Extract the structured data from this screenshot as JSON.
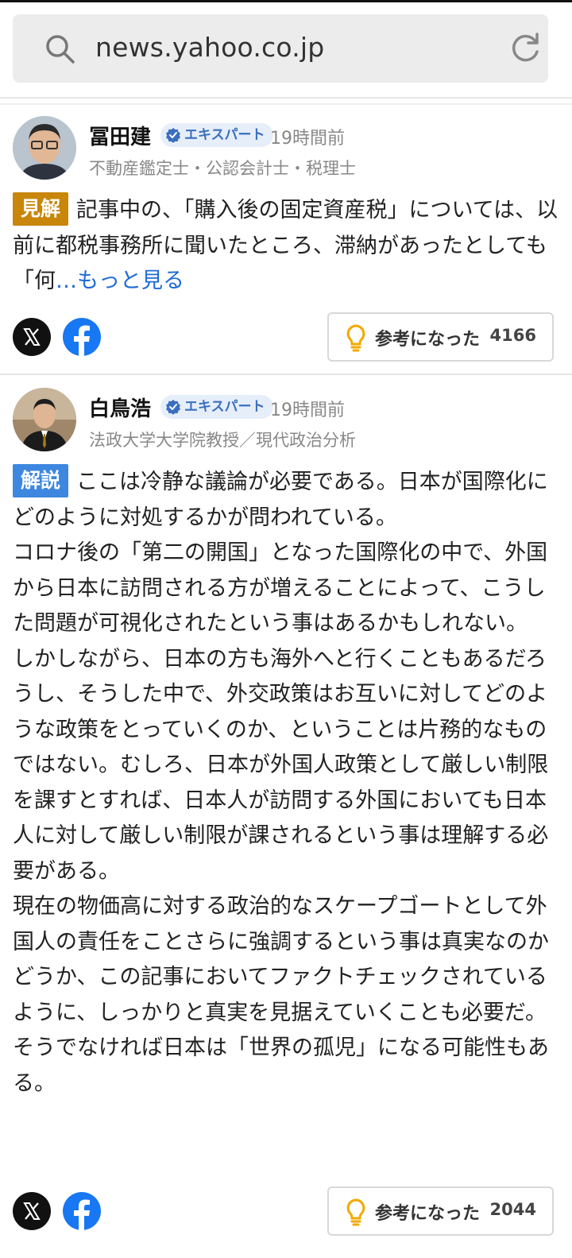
{
  "browser": {
    "url": "news.yahoo.co.jp"
  },
  "comments": [
    {
      "name": "冨田建",
      "badge": "エキスパート",
      "time": "19時間前",
      "role": "不動産鑑定士・公認会計士・税理士",
      "tag": "見解",
      "tag_color": "#c8860b",
      "text": "記事中の、「購入後の固定資産税」については、以前に都税事務所に聞いたところ、滞納があったとしても「何",
      "more": "…もっと見る",
      "helpful_label": "参考になった",
      "helpful_count": "4166"
    },
    {
      "name": "白鳥浩",
      "badge": "エキスパート",
      "time": "19時間前",
      "role": "法政大学大学院教授／現代政治分析",
      "tag": "解説",
      "tag_color": "#3d87e0",
      "text": "ここは冷静な議論が必要である。日本が国際化にどのように対処するかが問われている。\nコロナ後の「第二の開国」となった国際化の中で、外国から日本に訪問される方が増えることによって、こうした問題が可視化されたという事はあるかもしれない。\nしかしながら、日本の方も海外へと行くこともあるだろうし、そうした中で、外交政策はお互いに対してどのような政策をとっていくのか、ということは片務的なものではない。むしろ、日本が外国人政策として厳しい制限を課すとすれば、日本人が訪問する外国においても日本人に対して厳しい制限が課されるという事は理解する必要がある。\n現在の物価高に対する政治的なスケープゴートとして外国人の責任をことさらに強調するという事は真実なのかどうか、この記事においてファクトチェックされているように、しっかりと真実を見据えていくことも必要だ。\nそうでなければ日本は「世界の孤児」になる可能性もある。",
      "helpful_label": "参考になった",
      "helpful_count": "2044"
    }
  ],
  "icons": {
    "search": "search-icon",
    "reload": "reload-icon",
    "x": "x-logo-icon",
    "facebook": "facebook-icon",
    "bulb": "lightbulb-icon",
    "verified": "verified-check-icon"
  }
}
